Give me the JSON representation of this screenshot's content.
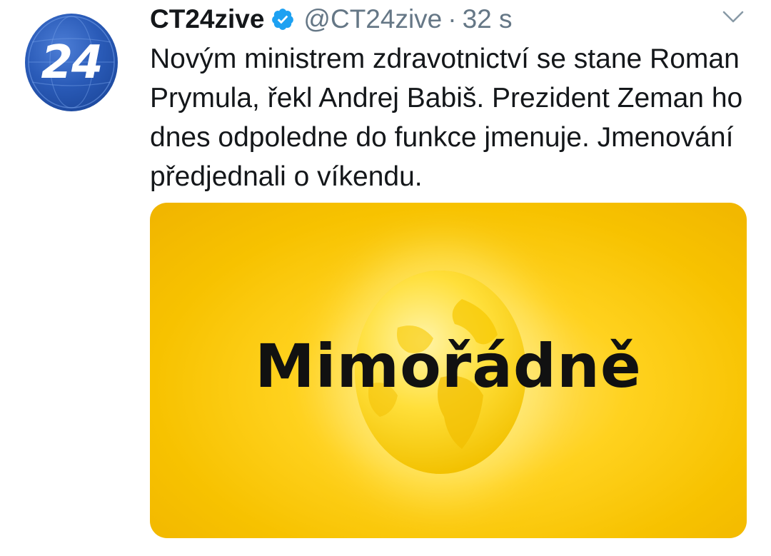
{
  "tweet": {
    "avatar_text": "24",
    "display_name": "CT24zive",
    "handle": "@CT24zive",
    "separator": "·",
    "time": "32 s",
    "text": "Novým ministrem zdravotnictví se stane Roman Prymula, řekl Andrej Babiš. Prezident Zeman ho dnes odpoledne do funkce jmenuje. Jmenování předjednali o víkendu.",
    "media": {
      "headline": "Mimořádně"
    }
  },
  "colors": {
    "verified": "#1da1f2",
    "secondary_text": "#657786",
    "media_yellow": "#ffd21f",
    "avatar_blue": "#2a5bb8"
  },
  "icons": {
    "verified": "verified-badge-icon",
    "menu": "chevron-down-icon"
  }
}
